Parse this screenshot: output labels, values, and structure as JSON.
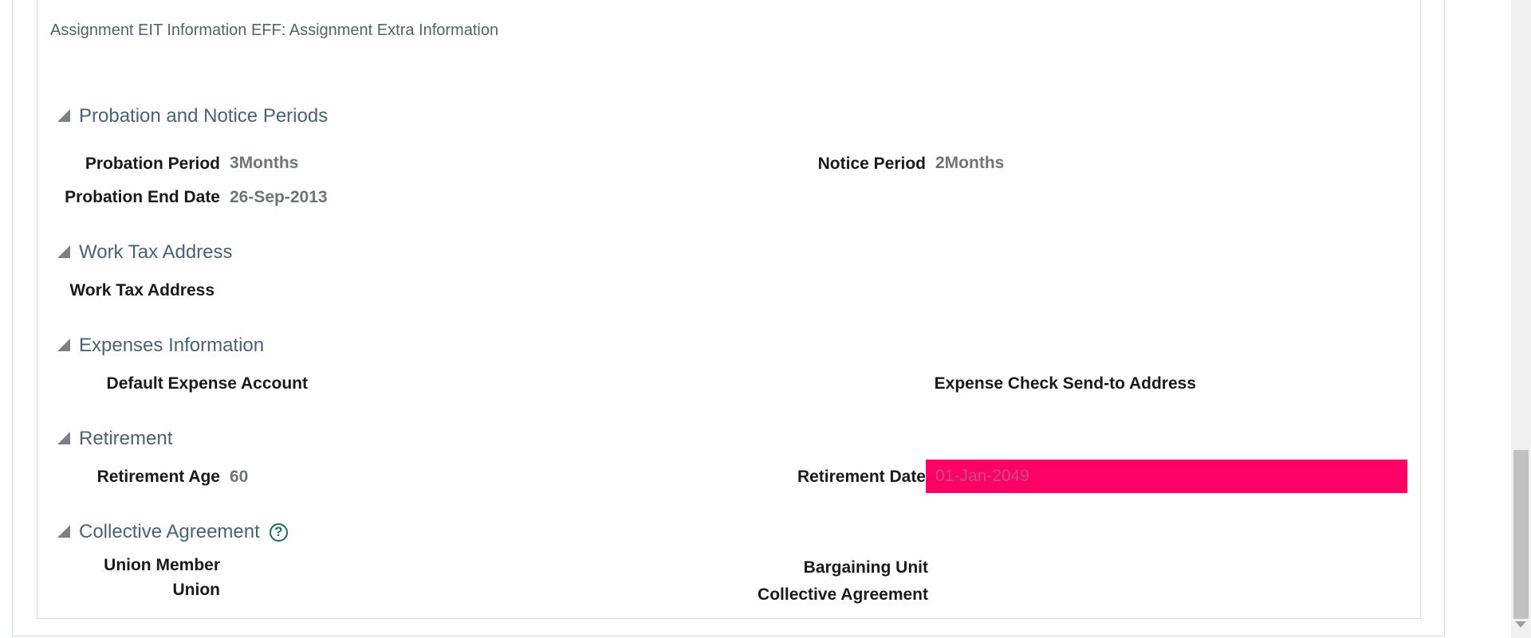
{
  "eff_title": "Assignment EIT Information EFF: Assignment Extra Information",
  "sections": {
    "probation": {
      "title": "Probation and Notice Periods",
      "probation_period_label": "Probation Period",
      "probation_period_value": "3Months",
      "notice_period_label": "Notice Period",
      "notice_period_value": "2Months",
      "probation_end_date_label": "Probation End Date",
      "probation_end_date_value": "26-Sep-2013"
    },
    "work_tax": {
      "title": "Work Tax Address",
      "work_tax_address_label": "Work Tax Address"
    },
    "expenses": {
      "title": "Expenses Information",
      "default_expense_account_label": "Default Expense Account",
      "expense_check_label": "Expense Check Send-to Address"
    },
    "retirement": {
      "title": "Retirement",
      "retirement_age_label": "Retirement Age",
      "retirement_age_value": "60",
      "retirement_date_label": "Retirement Date",
      "retirement_date_value": "01-Jan-2049"
    },
    "collective": {
      "title": "Collective Agreement",
      "help_icon": "question-circle-icon",
      "union_member_label": "Union Member",
      "union_label": "Union",
      "bargaining_unit_label": "Bargaining Unit",
      "collective_agreement_label": "Collective Agreement"
    }
  },
  "colors": {
    "highlight": "#ff0066",
    "section_title": "#4b6370",
    "help_icon": "#1d6a5c"
  }
}
